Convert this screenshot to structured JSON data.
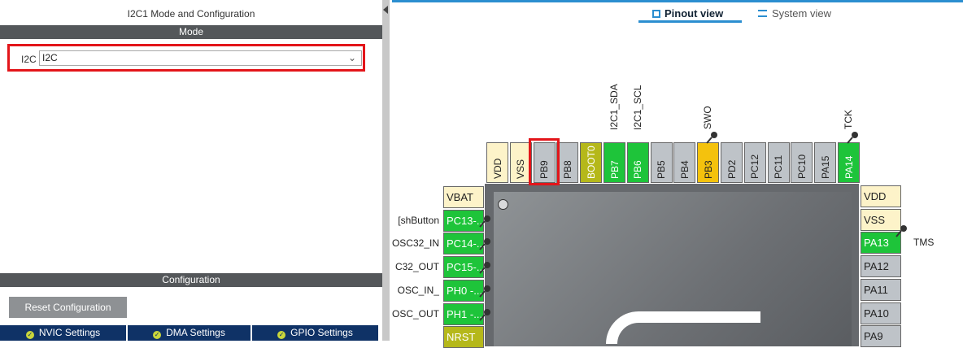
{
  "left_panel": {
    "title": "I2C1 Mode and Configuration",
    "mode_header": "Mode",
    "mode_field_label": "I2C",
    "mode_field_value": "I2C",
    "config_header": "Configuration",
    "reset_button": "Reset Configuration",
    "tabs": [
      {
        "label": "NVIC Settings"
      },
      {
        "label": "DMA Settings"
      },
      {
        "label": "GPIO Settings"
      }
    ]
  },
  "view_tabs": {
    "pinout": "Pinout view",
    "system": "System view",
    "active": "pinout"
  },
  "top_pins": [
    {
      "name": "VDD",
      "signal": "",
      "color": "#fdf3c9"
    },
    {
      "name": "VSS",
      "signal": "",
      "color": "#fdf3c9"
    },
    {
      "name": "PB9",
      "signal": "",
      "color": "#bec3c8",
      "highlighted": true
    },
    {
      "name": "PB8",
      "signal": "",
      "color": "#bec3c8"
    },
    {
      "name": "BOOT0",
      "signal": "",
      "color": "#b5b81a"
    },
    {
      "name": "PB7",
      "signal": "I2C1_SDA",
      "color": "#1ec43a"
    },
    {
      "name": "PB6",
      "signal": "I2C1_SCL",
      "color": "#1ec43a"
    },
    {
      "name": "PB5",
      "signal": "",
      "color": "#bec3c8"
    },
    {
      "name": "PB4",
      "signal": "",
      "color": "#bec3c8"
    },
    {
      "name": "PB3",
      "signal": "SWO",
      "color": "#f4c20d",
      "pinned": true
    },
    {
      "name": "PD2",
      "signal": "",
      "color": "#bec3c8"
    },
    {
      "name": "PC12",
      "signal": "",
      "color": "#bec3c8"
    },
    {
      "name": "PC11",
      "signal": "",
      "color": "#bec3c8"
    },
    {
      "name": "PC10",
      "signal": "",
      "color": "#bec3c8"
    },
    {
      "name": "PA15",
      "signal": "",
      "color": "#bec3c8"
    },
    {
      "name": "PA14",
      "signal": "TCK",
      "color": "#1ec43a",
      "pinned": true
    }
  ],
  "left_pins": [
    {
      "name": "VBAT",
      "signal": "",
      "color": "#fdf3c9"
    },
    {
      "name": "PC13-...",
      "signal": "shButton]",
      "color": "#1ec43a"
    },
    {
      "name": "PC14-...",
      "signal": "OSC32_IN",
      "color": "#1ec43a"
    },
    {
      "name": "PC15-...",
      "signal": "C32_OUT",
      "color": "#1ec43a"
    },
    {
      "name": "PH0 -...",
      "signal": "_OSC_IN",
      "color": "#1ec43a"
    },
    {
      "name": "PH1 -...",
      "signal": "OSC_OUT",
      "color": "#1ec43a"
    },
    {
      "name": "NRST",
      "signal": "",
      "color": "#b5b81a"
    }
  ],
  "right_pins": [
    {
      "name": "VDD",
      "signal": "",
      "color": "#fdf3c9"
    },
    {
      "name": "VSS",
      "signal": "",
      "color": "#fdf3c9"
    },
    {
      "name": "PA13",
      "signal": "TMS",
      "color": "#1ec43a"
    },
    {
      "name": "PA12",
      "signal": "",
      "color": "#bec3c8"
    },
    {
      "name": "PA11",
      "signal": "",
      "color": "#bec3c8"
    },
    {
      "name": "PA10",
      "signal": "",
      "color": "#bec3c8"
    },
    {
      "name": "PA9",
      "signal": "",
      "color": "#bec3c8"
    }
  ]
}
